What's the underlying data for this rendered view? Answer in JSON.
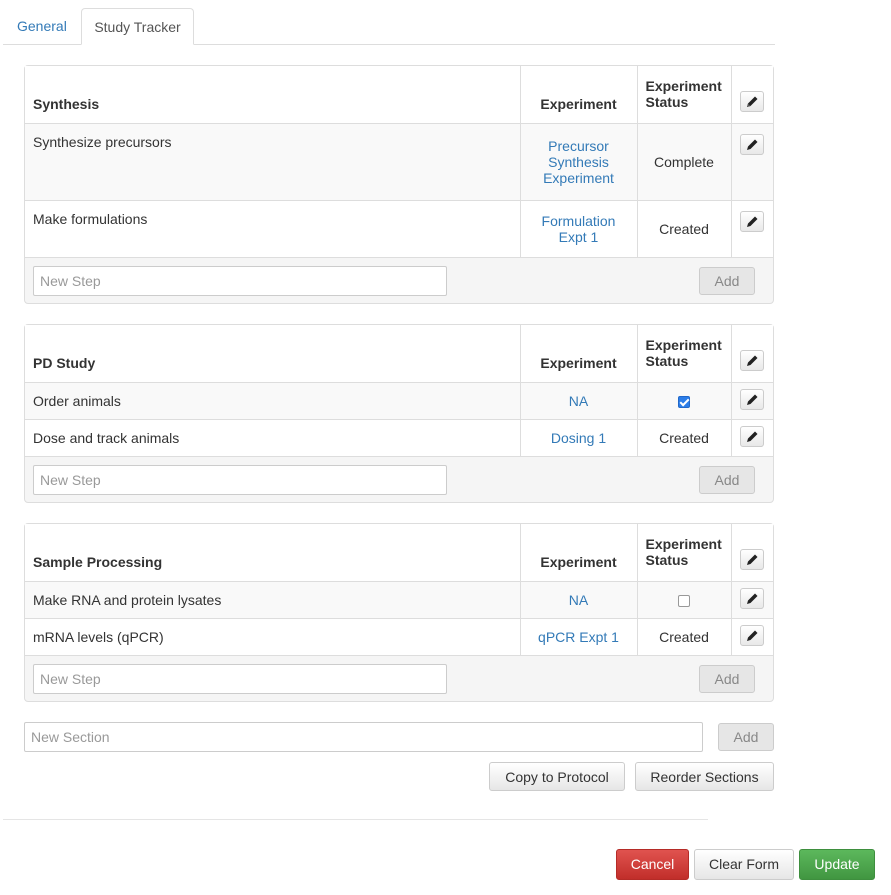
{
  "tabs": {
    "general": "General",
    "study_tracker": "Study Tracker"
  },
  "headers": {
    "experiment": "Experiment",
    "status_line1": "Experiment",
    "status_line2": "Status"
  },
  "sections": [
    {
      "title": "Synthesis",
      "rows": [
        {
          "step": "Synthesize precursors",
          "experiment_lines": [
            "Precursor",
            "Synthesis",
            "Experiment"
          ],
          "status": "Complete"
        },
        {
          "step": "Make formulations",
          "experiment_lines": [
            "Formulation",
            "Expt 1"
          ],
          "status": "Created"
        }
      ],
      "new_step_placeholder": "New Step",
      "add_label": "Add"
    },
    {
      "title": "PD Study",
      "rows": [
        {
          "step": "Order animals",
          "experiment": "NA",
          "status_checkbox": true
        },
        {
          "step": "Dose and track animals",
          "experiment": "Dosing 1",
          "status": "Created"
        }
      ],
      "new_step_placeholder": "New Step",
      "add_label": "Add"
    },
    {
      "title": "Sample Processing",
      "rows": [
        {
          "step": "Make RNA and protein lysates",
          "experiment": "NA",
          "status_checkbox": false
        },
        {
          "step": "mRNA levels (qPCR)",
          "experiment": "qPCR Expt 1",
          "status": "Created"
        }
      ],
      "new_step_placeholder": "New Step",
      "add_label": "Add"
    }
  ],
  "new_section": {
    "placeholder": "New Section",
    "add_label": "Add"
  },
  "actions": {
    "copy_to_protocol": "Copy to Protocol",
    "reorder_sections": "Reorder Sections"
  },
  "footer": {
    "cancel": "Cancel",
    "clear_form": "Clear Form",
    "update": "Update"
  },
  "colors": {
    "link": "#337ab7",
    "danger": "#d9534f",
    "success": "#5cb85c",
    "checkbox_checked": "#2b7de9"
  },
  "icons": {
    "edit": "pencil-icon"
  }
}
